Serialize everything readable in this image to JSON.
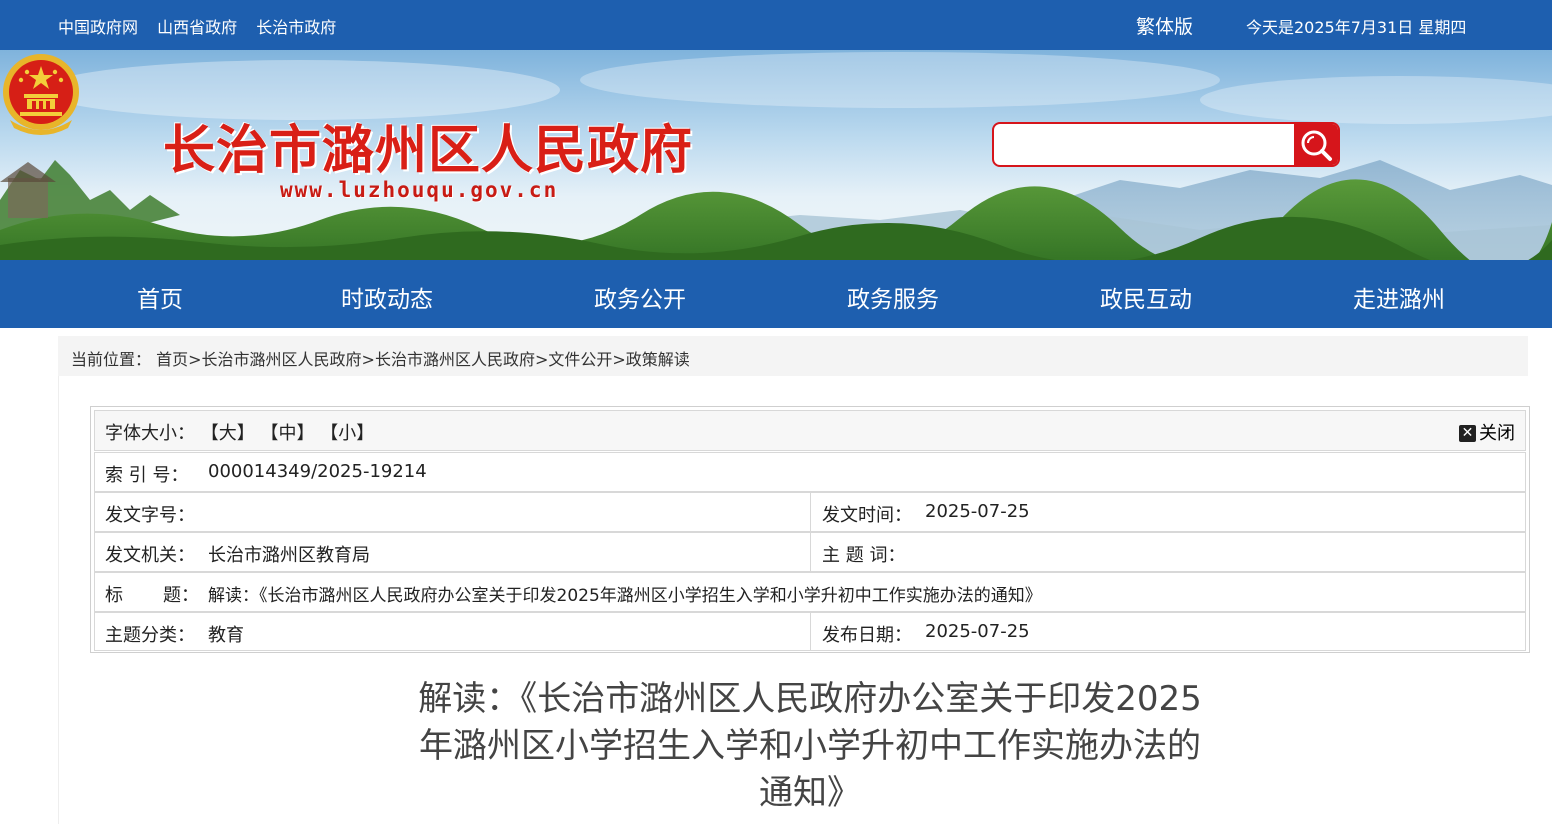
{
  "topbar": {
    "links": [
      "中国政府网",
      "山西省政府",
      "长治市政府"
    ],
    "traditional": "繁体版",
    "date": "今天是2025年7月31日 星期四"
  },
  "header": {
    "site_title": "长治市潞州区人民政府",
    "site_url": "www.luzhouqu.gov.cn",
    "search_placeholder": ""
  },
  "nav": [
    "首页",
    "时政动态",
    "政务公开",
    "政务服务",
    "政民互动",
    "走进潞州"
  ],
  "breadcrumb": {
    "label": "当前位置：",
    "items": [
      "首页",
      "长治市潞州区人民政府",
      "长治市潞州区人民政府",
      "文件公开",
      "政策解读"
    ],
    "separator": ">"
  },
  "meta": {
    "font_size_label": "字体大小：",
    "font_large": "【大】",
    "font_medium": "【中】",
    "font_small": "【小】",
    "close_label": "关闭",
    "index_label": "索 引 号：",
    "index_value": "000014349/2025-19214",
    "doc_no_label": "发文字号：",
    "doc_no_value": "",
    "issue_time_label": "发文时间：",
    "issue_time_value": "2025-07-25",
    "issuer_label": "发文机关：",
    "issuer_value": "长治市潞州区教育局",
    "keywords_label": "主 题 词：",
    "keywords_value": "",
    "title_label": "标       题：",
    "title_value": "解读：《长治市潞州区人民政府办公室关于印发2025年潞州区小学招生入学和小学升初中工作实施办法的通知》",
    "category_label": "主题分类：",
    "category_value": "教育",
    "publish_label": "发布日期：",
    "publish_value": "2025-07-25"
  },
  "article": {
    "title_line1": "解读：《长治市潞州区人民政府办公室关于印发2025",
    "title_line2": "年潞州区小学招生入学和小学升初中工作实施办法的",
    "title_line3": "通知》"
  },
  "colors": {
    "brand_blue": "#1e5faf",
    "title_red": "#d91f16",
    "search_red": "#d6151b"
  }
}
